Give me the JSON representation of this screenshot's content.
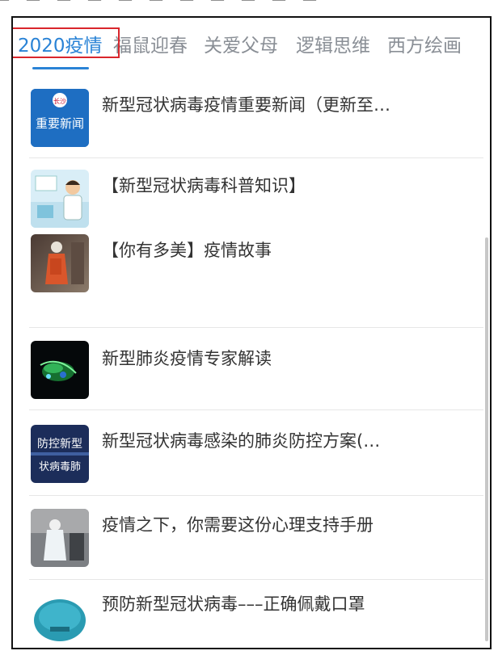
{
  "tabs": [
    {
      "label": "2020疫情",
      "active": true
    },
    {
      "label": "福鼠迎春",
      "active": false
    },
    {
      "label": "关爱父母",
      "active": false
    },
    {
      "label": "逻辑思维",
      "active": false
    },
    {
      "label": "西方绘画",
      "active": false
    }
  ],
  "articles": [
    {
      "title": "新型冠状病毒疫情重要新闻（更新至…",
      "thumb_text": "重要新闻",
      "thumb_badge": "长沙"
    },
    {
      "title": "【新型冠状病毒科普知识】"
    },
    {
      "title": "【你有多美】疫情故事"
    },
    {
      "title": "新型肺炎疫情专家解读"
    },
    {
      "title": "新型冠状病毒感染的肺炎防控方案(…",
      "thumb_text_line1": "防控新型",
      "thumb_text_line2": "状病毒肺"
    },
    {
      "title": "疫情之下，你需要这份心理支持手册"
    },
    {
      "title": "预防新型冠状病毒–––正确佩戴口罩"
    }
  ],
  "colors": {
    "accent": "#2a83d6",
    "highlight": "#d9262c",
    "inactive_tab": "#8a8f96"
  }
}
